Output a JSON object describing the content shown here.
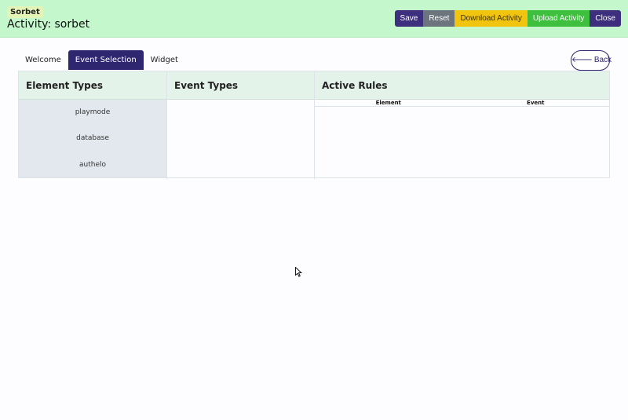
{
  "header": {
    "brand": "Sorbet",
    "activity_title": "Activity: sorbet",
    "buttons": {
      "save": "Save",
      "reset": "Reset",
      "download": "Download Activity",
      "upload": "Upload Activity",
      "close": "Close"
    }
  },
  "tabs": [
    {
      "label": "Welcome",
      "active": false
    },
    {
      "label": "Event Selection",
      "active": true
    },
    {
      "label": "Widget",
      "active": false
    }
  ],
  "back_label": "Back",
  "columns": {
    "element_types": {
      "title": "Element Types",
      "items": [
        "playmode",
        "database",
        "authelo"
      ]
    },
    "event_types": {
      "title": "Event Types",
      "items": []
    },
    "active_rules": {
      "title": "Active Rules",
      "headers": [
        "Element",
        "Event"
      ],
      "rows": []
    }
  },
  "colors": {
    "topbar_bg": "#c4f7cb",
    "brand_badge_bg": "#e4f4b6",
    "primary": "#3d2f7d",
    "active_tab": "#2f2670",
    "secondary": "#6c757d",
    "warning": "#f1c40f",
    "success": "#3ec03e",
    "table_head_bg": "#e4f3ea",
    "element_col_bg": "#e3e8ef"
  }
}
